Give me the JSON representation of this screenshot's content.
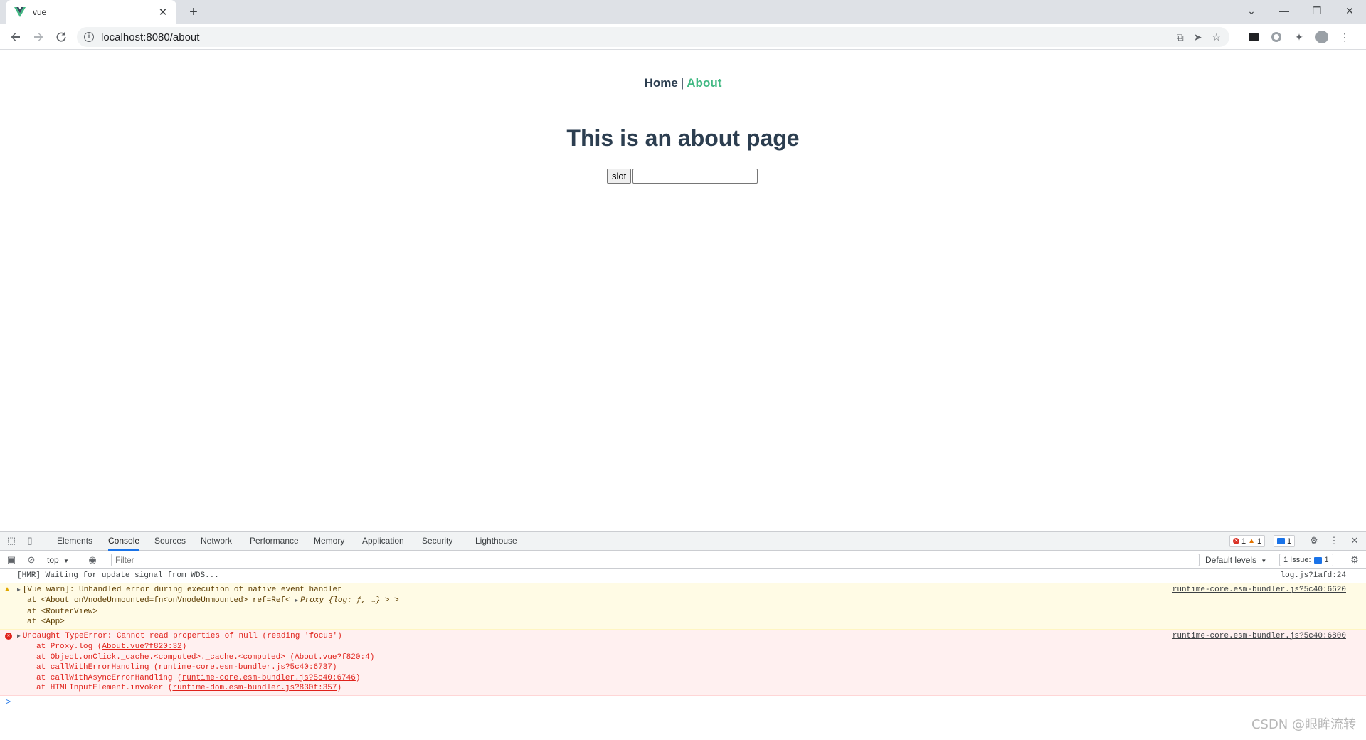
{
  "browser": {
    "tab_title": "vue",
    "url": "localhost:8080/about"
  },
  "page": {
    "nav": {
      "home": "Home",
      "separator": "|",
      "about": "About"
    },
    "title": "This is an about page",
    "slot_button": "slot",
    "slot_input_value": ""
  },
  "devtools": {
    "tabs": [
      "Elements",
      "Console",
      "Sources",
      "Network",
      "Performance",
      "Memory",
      "Application",
      "Security",
      "Lighthouse"
    ],
    "active_tab": "Console",
    "error_count": "1",
    "warning_count": "1",
    "message_count": "1",
    "context": "top",
    "filter_placeholder": "Filter",
    "levels": "Default levels",
    "issues_label": "1 Issue:",
    "issues_count": "1",
    "colors": {
      "accent": "#1a73e8",
      "error": "#e0221b",
      "warning": "#e0a800",
      "vue_green": "#42b983"
    }
  },
  "console": {
    "hmr": {
      "text": "[HMR] Waiting for update signal from WDS...",
      "source": "log.js?1afd:24"
    },
    "warn": {
      "text": "[Vue warn]: Unhandled error during execution of native event handler",
      "source": "runtime-core.esm-bundler.js?5c40:6620",
      "line1": "at <About onVnodeUnmounted=fn<onVnodeUnmounted> ref=Ref< ",
      "line1_proxy": "Proxy {log: ƒ, …}",
      "line1_end": " > >",
      "line2": "at <RouterView>",
      "line3": "at <App>"
    },
    "error": {
      "text": "Uncaught TypeError: Cannot read properties of null (reading 'focus')",
      "source": "runtime-core.esm-bundler.js?5c40:6800",
      "frames": [
        {
          "prefix": "at Proxy.log (",
          "link": "About.vue?f820:32",
          "suffix": ")"
        },
        {
          "prefix": "at Object.onClick._cache.<computed>._cache.<computed> (",
          "link": "About.vue?f820:4",
          "suffix": ")"
        },
        {
          "prefix": "at callWithErrorHandling (",
          "link": "runtime-core.esm-bundler.js?5c40:6737",
          "suffix": ")"
        },
        {
          "prefix": "at callWithAsyncErrorHandling (",
          "link": "runtime-core.esm-bundler.js?5c40:6746",
          "suffix": ")"
        },
        {
          "prefix": "at HTMLInputElement.invoker (",
          "link": "runtime-dom.esm-bundler.js?830f:357",
          "suffix": ")"
        }
      ]
    },
    "prompt": ">"
  },
  "watermark": "CSDN @眼眸流转"
}
